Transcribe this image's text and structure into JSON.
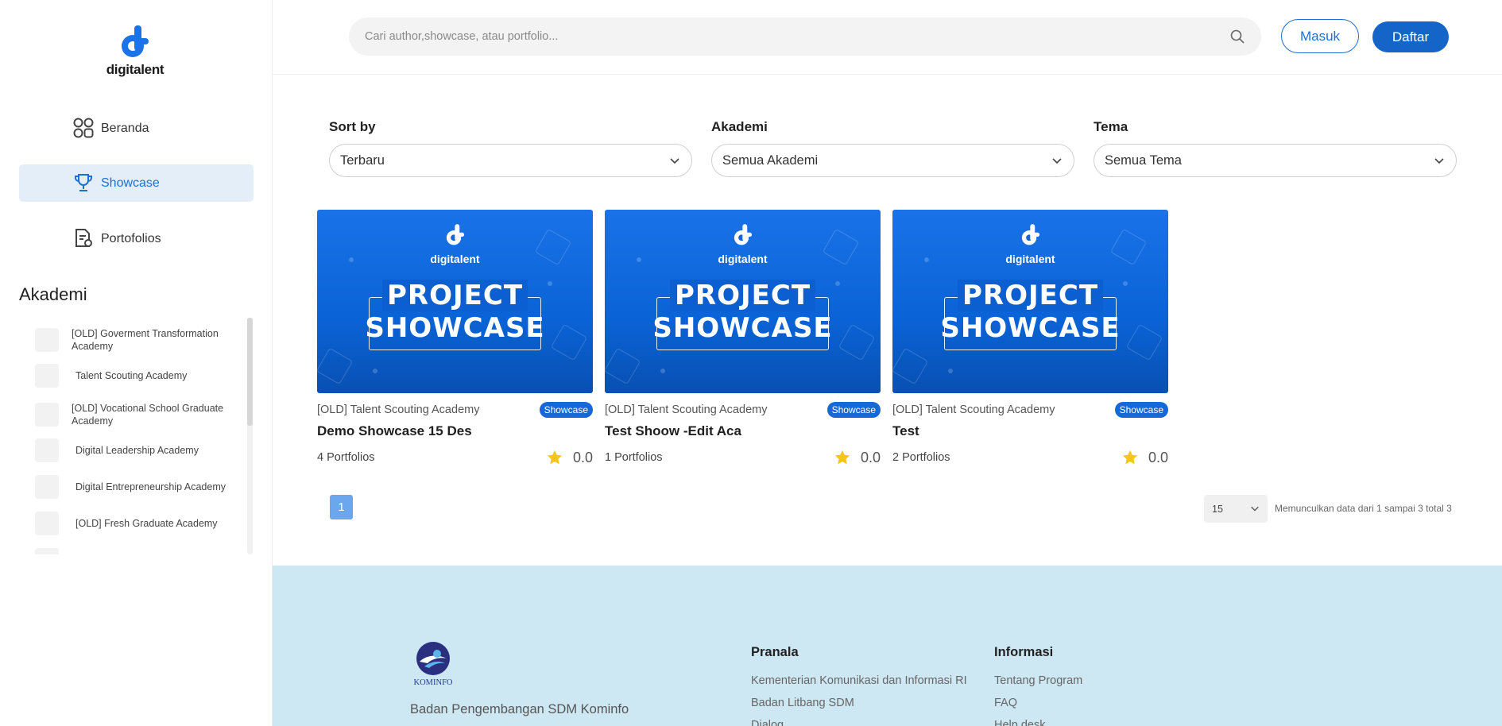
{
  "brand": {
    "name": "digitalent",
    "primary": "#1565c8",
    "accent_light": "#e3eef9"
  },
  "sidebar": {
    "nav": [
      {
        "label": "Beranda",
        "icon": "grid-icon"
      },
      {
        "label": "Showcase",
        "icon": "trophy-icon",
        "active": true
      },
      {
        "label": "Portofolios",
        "icon": "document-search-icon"
      }
    ],
    "akademi_title": "Akademi",
    "akademi": [
      "[OLD] Goverment Transformation Academy",
      "Talent Scouting Academy",
      "[OLD] Vocational School Graduate Academy",
      "Digital Leadership Academy",
      "Digital Entrepreneurship Academy",
      "[OLD] Fresh Graduate Academy"
    ]
  },
  "header": {
    "search_placeholder": "Cari author,showcase, atau portfolio...",
    "login": "Masuk",
    "register": "Daftar"
  },
  "filters": [
    {
      "label": "Sort by",
      "value": "Terbaru"
    },
    {
      "label": "Akademi",
      "value": "Semua Akademi"
    },
    {
      "label": "Tema",
      "value": "Semua Tema"
    }
  ],
  "thumbnail": {
    "brand": "digitalent",
    "line1": "PROJECT",
    "line2": "SHOWCASE"
  },
  "cards": [
    {
      "akademi": "[OLD] Talent Scouting Academy",
      "badge": "Showcase",
      "title": "Demo Showcase 15 Des",
      "count": "4 Portfolios",
      "rating": "0.0"
    },
    {
      "akademi": "[OLD] Talent Scouting Academy",
      "badge": "Showcase",
      "title": "Test Shoow -Edit Aca",
      "count": "1 Portfolios",
      "rating": "0.0"
    },
    {
      "akademi": "[OLD] Talent Scouting Academy",
      "badge": "Showcase",
      "title": "Test",
      "count": "2 Portfolios",
      "rating": "0.0"
    }
  ],
  "pagination": {
    "current": "1",
    "per_page": "15",
    "info": "Memunculkan data dari 1 sampai 3 total 3"
  },
  "footer": {
    "logo_text": "KOMINFO",
    "description": "Badan Pengembangan SDM Kominfo",
    "pranala_title": "Pranala",
    "pranala": [
      "Kementerian Komunikasi dan Informasi RI",
      "Badan Litbang SDM",
      "Dialog"
    ],
    "informasi_title": "Informasi",
    "informasi": [
      "Tentang Program",
      "FAQ",
      "Help desk"
    ]
  }
}
